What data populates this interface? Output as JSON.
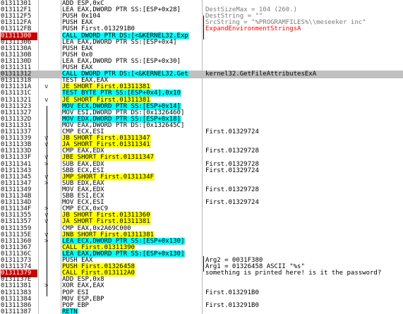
{
  "colors": {
    "jump_highlight": "#ffff00",
    "call_operand_highlight": "#00ffff",
    "breakpoint_address": "#cc0000",
    "current_row": "#c0c0c0",
    "comment_alert": "#ff0000"
  },
  "rows": [
    {
      "addr": "01311301",
      "mk": "",
      "mnem": "ADD ESP,0xC",
      "style": "plain",
      "cmt": "",
      "bp": false,
      "hl": false
    },
    {
      "addr": "013112F1",
      "mk": "",
      "mnem": "LEA EAX,DWORD PTR SS:[ESP+0x28]",
      "style": "plain",
      "cmt": "DestSizeMax = 104 (260.)",
      "cmtStyle": "gray",
      "bp": false,
      "hl": false
    },
    {
      "addr": "013112F5",
      "mk": "",
      "mnem": "PUSH 0x104",
      "style": "plain",
      "cmt": "DestString = \"\"",
      "cmtStyle": "gray",
      "bp": false,
      "hl": false
    },
    {
      "addr": "013112FA",
      "mk": "",
      "mnem": "PUSH EAX",
      "style": "plain",
      "cmt": "SrcString = \"%PROGRAMFILES%\\\\meseeker inc\"",
      "cmtStyle": "gray",
      "bp": false,
      "hl": false
    },
    {
      "addr": "013112FB",
      "mk": "",
      "mnem": "PUSH First.013291B0",
      "style": "plain",
      "cmt": "ExpandEnvironmentStringsA",
      "cmtStyle": "red",
      "bp": false,
      "hl": false
    },
    {
      "addr": "01311300",
      "mk": "",
      "mnem": "CALL DWORD PTR DS:[<&KERNEL32.Exp",
      "style": "call",
      "cmt": "",
      "bp": true,
      "hl": false
    },
    {
      "addr": "01311306",
      "mk": "",
      "mnem": "LEA EAX,DWORD PTR SS:[ESP+0x4]",
      "style": "plain",
      "cmt": "",
      "bp": false,
      "hl": false
    },
    {
      "addr": "0131130A",
      "mk": "",
      "mnem": "PUSH EAX",
      "style": "plain",
      "cmt": "",
      "bp": false,
      "hl": false
    },
    {
      "addr": "0131130B",
      "mk": "",
      "mnem": "PUSH 0x0",
      "style": "plain",
      "cmt": "",
      "bp": false,
      "hl": false
    },
    {
      "addr": "0131130D",
      "mk": "",
      "mnem": "LEA EAX,DWORD PTR SS:[ESP+0x30]",
      "style": "plain",
      "cmt": "",
      "bp": false,
      "hl": false
    },
    {
      "addr": "01311311",
      "mk": "",
      "mnem": "PUSH EAX",
      "style": "plain",
      "cmt": "",
      "bp": false,
      "hl": false
    },
    {
      "addr": "01311312",
      "mk": "",
      "mnem": "CALL DWORD PTR DS:[<&KERNEL32.Get",
      "style": "call",
      "cmt": "kernel32.GetFileAttributesExA",
      "cmtStyle": "plain",
      "bp": false,
      "hl": true
    },
    {
      "addr": "01311318",
      "mk": "",
      "mnem": "TEST EAX,EAX",
      "style": "plain",
      "cmt": "",
      "bp": false,
      "hl": false
    },
    {
      "addr": "0131131A",
      "mk": "v",
      "mnem": "JE SHORT First.01311381",
      "style": "jmp",
      "cmt": "",
      "bp": false,
      "hl": false
    },
    {
      "addr": "0131131C",
      "mk": "",
      "mnem": "TEST BYTE PTR SS:[ESP+0x4],0x10",
      "style": "call",
      "cmt": "",
      "bp": false,
      "hl": false
    },
    {
      "addr": "01311321",
      "mk": "v",
      "mnem": "JE SHORT First.01311381",
      "style": "jmp",
      "cmt": "",
      "bp": false,
      "hl": false
    },
    {
      "addr": "01311323",
      "mk": "",
      "mnem": "MOV ECX,DWORD PTR SS:[ESP+0x14]",
      "style": "call",
      "cmt": "",
      "bp": false,
      "hl": false
    },
    {
      "addr": "01311327",
      "mk": "",
      "mnem": "MOV ESI,DWORD PTR DS:[0x1326460]",
      "style": "plain",
      "cmt": "",
      "bp": false,
      "hl": false
    },
    {
      "addr": "0131132D",
      "mk": "",
      "mnem": "MOV EDX,DWORD PTR SS:[ESP+0x18]",
      "style": "call",
      "cmt": "",
      "bp": false,
      "hl": false
    },
    {
      "addr": "01311331",
      "mk": "",
      "mnem": "MOV EAX,DWORD PTR DS:[0x132645C]",
      "style": "plain",
      "cmt": "",
      "bp": false,
      "hl": false
    },
    {
      "addr": "01311337",
      "mk": "",
      "mnem": "CMP ECX,ESI",
      "style": "plain",
      "cmt": "First.01329724",
      "cmtStyle": "plain",
      "bp": false,
      "hl": false
    },
    {
      "addr": "01311339",
      "mk": "v",
      "mnem": "JB SHORT First.01311347",
      "style": "jmp",
      "cmt": "",
      "bp": false,
      "hl": false
    },
    {
      "addr": "0131133B",
      "mk": "v",
      "mnem": "JA SHORT First.01311341",
      "style": "jmp",
      "cmt": "",
      "bp": false,
      "hl": false
    },
    {
      "addr": "0131133D",
      "mk": "",
      "mnem": "CMP EAX,EDX",
      "style": "plain",
      "cmt": "First.01329728",
      "cmtStyle": "plain",
      "bp": false,
      "hl": false
    },
    {
      "addr": "0131133F",
      "mk": "v",
      "mnem": "JBE SHORT First.01311347",
      "style": "jmp",
      "cmt": "",
      "bp": false,
      "hl": false
    },
    {
      "addr": "01311341",
      "mk": ">",
      "mnem": "SUB EAX,EDX",
      "style": "plain",
      "cmt": "First.01329728",
      "cmtStyle": "plain",
      "bp": false,
      "hl": false
    },
    {
      "addr": "01311343",
      "mk": "",
      "mnem": "SBB ECX,ESI",
      "style": "plain",
      "cmt": "First.01329724",
      "cmtStyle": "plain",
      "bp": false,
      "hl": false
    },
    {
      "addr": "01311345",
      "mk": "v",
      "mnem": "JMP SHORT First.0131134F",
      "style": "jmp",
      "cmt": "",
      "bp": false,
      "hl": false
    },
    {
      "addr": "01311347",
      "mk": ">",
      "mnem": "SUB EDX,EAX",
      "style": "plain",
      "cmt": "",
      "bp": false,
      "hl": false
    },
    {
      "addr": "01311349",
      "mk": "",
      "mnem": "MOV EAX,EDX",
      "style": "plain",
      "cmt": "First.01329728",
      "cmtStyle": "plain",
      "bp": false,
      "hl": false
    },
    {
      "addr": "0131134B",
      "mk": "",
      "mnem": "SBB ESI,ECX",
      "style": "plain",
      "cmt": "",
      "bp": false,
      "hl": false
    },
    {
      "addr": "0131134D",
      "mk": "",
      "mnem": "MOV ECX,ESI",
      "style": "plain",
      "cmt": "First.01329724",
      "cmtStyle": "plain",
      "bp": false,
      "hl": false
    },
    {
      "addr": "0131134F",
      "mk": ">",
      "mnem": "CMP ECX,0xC9",
      "style": "plain",
      "cmt": "",
      "bp": false,
      "hl": false
    },
    {
      "addr": "01311355",
      "mk": "v",
      "mnem": "JB SHORT First.01311360",
      "style": "jmp",
      "cmt": "",
      "bp": false,
      "hl": false
    },
    {
      "addr": "01311357",
      "mk": "v",
      "mnem": "JA SHORT First.01311381",
      "style": "jmp",
      "cmt": "",
      "bp": false,
      "hl": false
    },
    {
      "addr": "01311359",
      "mk": "",
      "mnem": "CMP EAX,0x2A69C000",
      "style": "plain",
      "cmt": "",
      "bp": false,
      "hl": false
    },
    {
      "addr": "0131135E",
      "mk": "v",
      "mnem": "JNB SHORT First.01311381",
      "style": "jmp",
      "cmt": "",
      "bp": false,
      "hl": false
    },
    {
      "addr": "01311360",
      "mk": ">",
      "mnem": "LEA ECX,DWORD PTR SS:[ESP+0x130]",
      "style": "call",
      "cmt": "",
      "bp": false,
      "hl": false
    },
    {
      "addr": "01311367",
      "mk": "",
      "mnem": "CALL First.01311390",
      "style": "jmp",
      "cmt": "",
      "bp": false,
      "hl": false
    },
    {
      "addr": "0131136C",
      "mk": "",
      "mnem": "LEA EAX,DWORD PTR SS:[ESP+0x130]",
      "style": "call",
      "cmt": "",
      "bp": false,
      "hl": false
    },
    {
      "addr": "01311373",
      "mk": "",
      "mnem": "PUSH EAX",
      "style": "plain",
      "cmt": "Arg2 = 0031F380",
      "cmtStyle": "plain",
      "bp": false,
      "hl": false
    },
    {
      "addr": "01311374",
      "mk": "",
      "mnem": "PUSH First.01326458",
      "style": "jmp",
      "cmt": "Arg1 = 01326458 ASCII \"%s\"",
      "cmtStyle": "plain",
      "bp": false,
      "hl": false
    },
    {
      "addr": "01311379",
      "mk": "",
      "mnem": "CALL First.013112A0",
      "style": "jmp",
      "cmt": "something is printed here! is it the password?",
      "cmtStyle": "plain",
      "bp": true,
      "hl": false
    },
    {
      "addr": "0131137E",
      "mk": "",
      "mnem": "ADD ESP,0x8",
      "style": "plain",
      "cmt": "",
      "bp": false,
      "hl": false
    },
    {
      "addr": "01311381",
      "mk": ">",
      "mnem": "XOR EAX,EAX",
      "style": "plain",
      "cmt": "",
      "bp": false,
      "hl": false
    },
    {
      "addr": "01311383",
      "mk": "",
      "mnem": "POP ESI",
      "style": "plain",
      "cmt": "First.013291B0",
      "cmtStyle": "plain",
      "bp": false,
      "hl": false
    },
    {
      "addr": "01311384",
      "mk": "",
      "mnem": "MOV ESP,EBP",
      "style": "plain",
      "cmt": "",
      "bp": false,
      "hl": false
    },
    {
      "addr": "01311386",
      "mk": "",
      "mnem": "POP EBP",
      "style": "plain",
      "cmt": "First.013291B0",
      "cmtStyle": "plain",
      "bp": false,
      "hl": false
    },
    {
      "addr": "01311387",
      "mk": "",
      "mnem": "RETN",
      "style": "call",
      "cmt": "",
      "bp": false,
      "hl": false
    }
  ]
}
